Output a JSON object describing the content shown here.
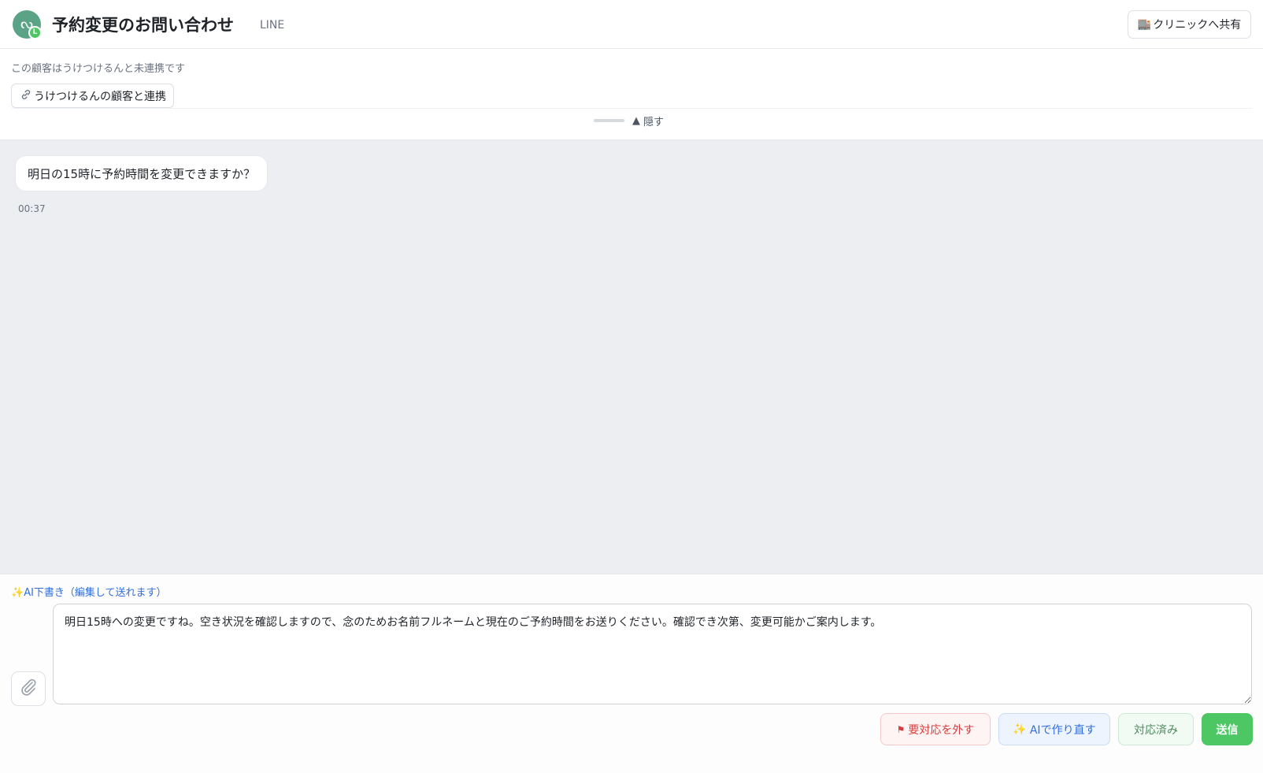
{
  "header": {
    "title": "予約変更のお問い合わせ",
    "channel": "LINE",
    "share_label": "クリニックへ共有",
    "share_icon": "building-icon"
  },
  "link_panel": {
    "note": "この顧客はうけつけるんと未連携です",
    "link_label": "うけつけるんの顧客と連携",
    "link_icon": "chain-link-icon",
    "hide_label": "隠す"
  },
  "chat": {
    "messages": [
      {
        "text": "明日の15時に予約時間を変更できますか？",
        "time": "00:37"
      }
    ]
  },
  "composer": {
    "ai_label": "AI下書き（編集して送れます）",
    "draft_text": "明日15時への変更ですね。空き状況を確認しますので、念のためお名前フルネームと現在のご予約時間をお送りください。確認でき次第、変更可能かご案内します。",
    "buttons": {
      "flag": "要対応を外す",
      "regenerate": "AIで作り直す",
      "done": "対応済み",
      "send": "送信"
    }
  },
  "colors": {
    "line_green": "#4cc764",
    "ai_blue": "#2f6fdb",
    "danger_red": "#d63c3c",
    "chat_bg": "#edeef2"
  }
}
